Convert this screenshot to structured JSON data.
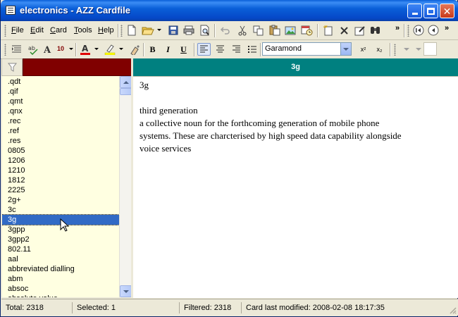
{
  "window": {
    "title": "electronics - AZZ Cardfile"
  },
  "menu": [
    {
      "label": "File",
      "accel": "F",
      "rest": "ile"
    },
    {
      "label": "Edit",
      "accel": "E",
      "rest": "dit"
    },
    {
      "label": "Card",
      "accel": "C",
      "rest": "ard"
    },
    {
      "label": "Tools",
      "accel": "T",
      "rest": "ools"
    },
    {
      "label": "Help",
      "accel": "H",
      "rest": "elp"
    }
  ],
  "toolbar": {
    "font_size": "10",
    "font_name": "Garamond",
    "bold": "B",
    "italic": "I",
    "underline": "U",
    "superscript": "x²",
    "subscript": "x₂",
    "overflow_chevron": "»"
  },
  "filter": {
    "value": "",
    "color": "#800000"
  },
  "list": {
    "items": [
      ".qdt",
      ".qif",
      ".qmt",
      ".qnx",
      ".rec",
      ".ref",
      ".res",
      "0805",
      "1206",
      "1210",
      "1812",
      "2225",
      "2g+",
      "3c",
      "3g",
      "3gpp",
      "3gpp2",
      "802.11",
      "aal",
      "abbreviated dialling",
      "abm",
      "absoc",
      "absolute value"
    ],
    "selected_index": 14,
    "selection_color": "#316ac5"
  },
  "card": {
    "header": "3g",
    "header_color": "#008080",
    "body": {
      "title": "3g",
      "line1": "third generation",
      "line2": "a collective noun for the forthcoming generation of mobile phone",
      "line3": "systems. These are charcterised by high speed data capability alongside",
      "line4": "voice services"
    }
  },
  "status": {
    "total": "Total: 2318",
    "selected": "Selected: 1",
    "filtered": "Filtered: 2318",
    "modified": "Card last modified: 2008-02-08  18:17:35"
  }
}
